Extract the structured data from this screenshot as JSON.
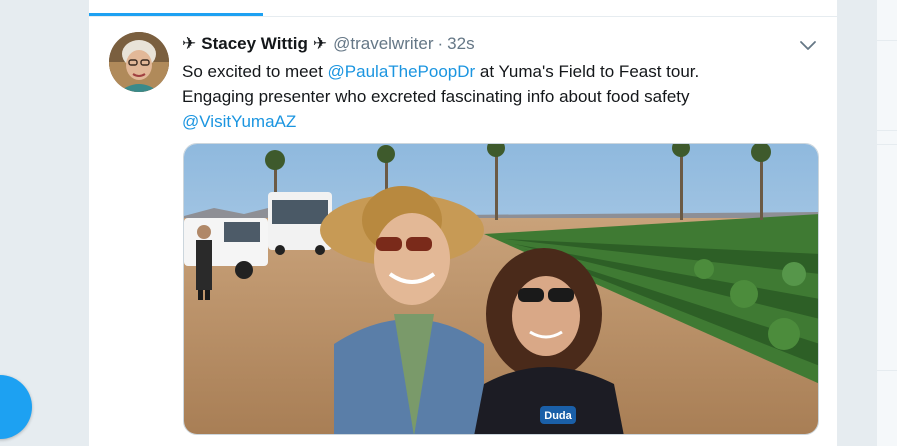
{
  "tweet": {
    "plane_left": "✈",
    "display_name": "Stacey Wittig",
    "plane_right": "✈",
    "handle": "@travelwriter",
    "separator": "·",
    "time": "32s",
    "text_prefix": "So excited to meet ",
    "mention_1": "@PaulaThePoopDr",
    "text_mid": " at Yuma's Field to Feast tour.",
    "text_line2": "Engaging presenter who excreted fascinating info about food safety",
    "mention_2": "@VisitYumaAZ"
  },
  "photo": {
    "vest_logo": "Duda"
  },
  "icons": {
    "caret": "chevron-down-icon",
    "compose": "compose-fab-icon"
  },
  "colors": {
    "accent": "#1da1f2",
    "link": "#1b95e0",
    "text": "#14171a",
    "muted": "#657786",
    "border": "#e6ecf0"
  }
}
